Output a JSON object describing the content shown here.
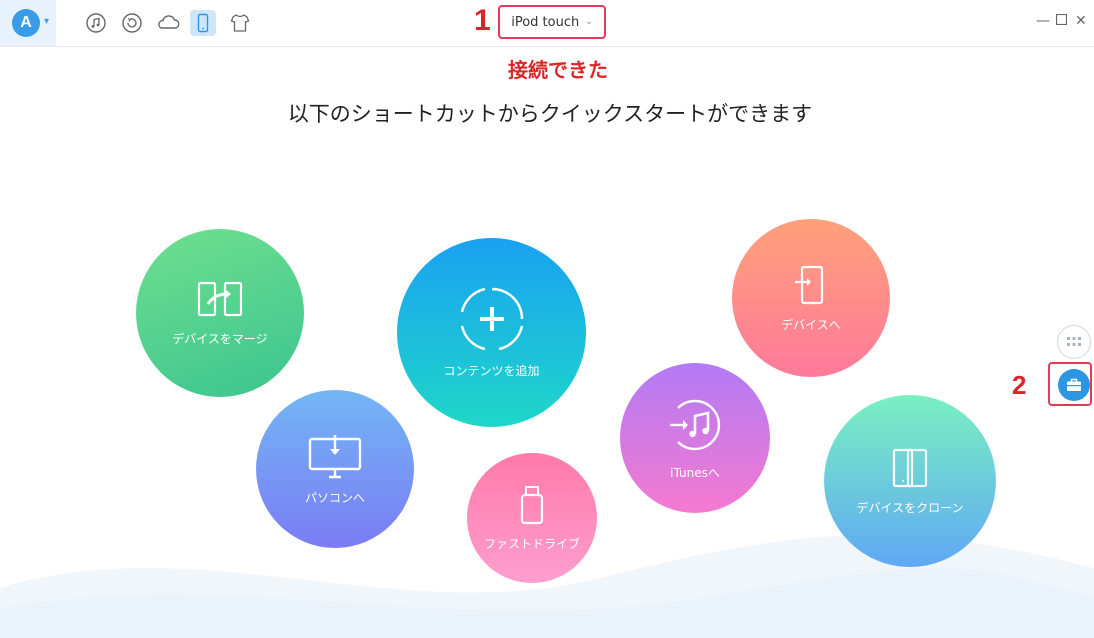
{
  "toolbar": {
    "logo_letter": "A",
    "icons": [
      "music-icon",
      "history-icon",
      "cloud-icon",
      "device-icon",
      "shirt-icon"
    ]
  },
  "device_selector": {
    "label": "iPod touch"
  },
  "annotations": {
    "num1": "1",
    "num2": "2",
    "connected_text": "接続できた"
  },
  "headline": "以下のショートカットからクイックスタートができます",
  "shortcuts": {
    "merge": "デバイスをマージ",
    "add_content": "コンテンツを追加",
    "to_device": "デバイスへ",
    "to_pc": "パソコンへ",
    "fast_drive": "ファストドライブ",
    "to_itunes": "iTunesへ",
    "clone": "デバイスをクローン"
  },
  "colors": {
    "accent": "#2d96e3",
    "annotation": "#d92626",
    "merge": [
      "#6ee08f",
      "#3cc48f"
    ],
    "add_content": [
      "#1aa1f2",
      "#1ed7c8"
    ],
    "to_device": [
      "#ffa07a",
      "#ff7a9a"
    ],
    "to_pc": [
      "#73b6f5",
      "#7a7cf5"
    ],
    "fast_drive": [
      "#ff7aa8",
      "#ff9ed0"
    ],
    "to_itunes": [
      "#b27af5",
      "#f57ad0"
    ],
    "clone": [
      "#7af0c0",
      "#5fa8f5"
    ]
  }
}
